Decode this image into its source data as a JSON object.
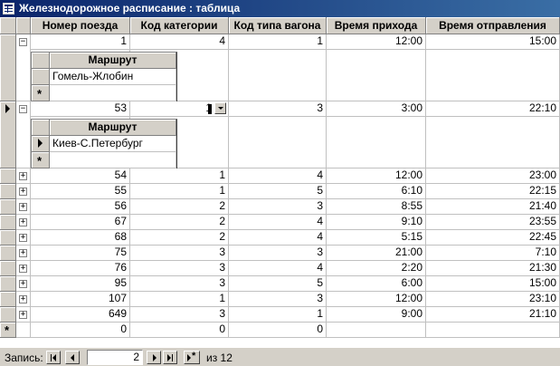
{
  "window": {
    "title": "Железнодорожное расписание : таблица"
  },
  "columns": [
    "Номер поезда",
    "Код категории",
    "Код типа вагона",
    "Время прихода",
    "Время отправления"
  ],
  "rows": [
    {
      "num": "1",
      "cat": "4",
      "type": "1",
      "arr": "12:00",
      "dep": "15:00",
      "expanded": true,
      "current": false
    },
    {
      "num": "53",
      "cat": "1",
      "type": "3",
      "arr": "3:00",
      "dep": "22:10",
      "expanded": true,
      "current": true
    },
    {
      "num": "54",
      "cat": "1",
      "type": "4",
      "arr": "12:00",
      "dep": "23:00"
    },
    {
      "num": "55",
      "cat": "1",
      "type": "5",
      "arr": "6:10",
      "dep": "22:15"
    },
    {
      "num": "56",
      "cat": "2",
      "type": "3",
      "arr": "8:55",
      "dep": "21:40"
    },
    {
      "num": "67",
      "cat": "2",
      "type": "4",
      "arr": "9:10",
      "dep": "23:55"
    },
    {
      "num": "68",
      "cat": "2",
      "type": "4",
      "arr": "5:15",
      "dep": "22:45"
    },
    {
      "num": "75",
      "cat": "3",
      "type": "3",
      "arr": "21:00",
      "dep": "7:10"
    },
    {
      "num": "76",
      "cat": "3",
      "type": "4",
      "arr": "2:20",
      "dep": "21:30"
    },
    {
      "num": "95",
      "cat": "3",
      "type": "5",
      "arr": "6:00",
      "dep": "15:00"
    },
    {
      "num": "107",
      "cat": "1",
      "type": "3",
      "arr": "12:00",
      "dep": "23:10"
    },
    {
      "num": "649",
      "cat": "3",
      "type": "1",
      "arr": "9:00",
      "dep": "21:10"
    }
  ],
  "new_row": {
    "num": "0",
    "cat": "0",
    "type": "0"
  },
  "subforms": [
    {
      "header": "Маршрут",
      "value": "Гомель-Жлобин"
    },
    {
      "header": "Маршрут",
      "value": "Киев-С.Петербург"
    }
  ],
  "navigator": {
    "label": "Запись:",
    "current": "2",
    "of_text": "из  12"
  },
  "icons": {
    "expanded": "minus-icon",
    "collapsed": "plus-icon",
    "current": "record-pointer-icon",
    "new": "new-record-icon"
  }
}
